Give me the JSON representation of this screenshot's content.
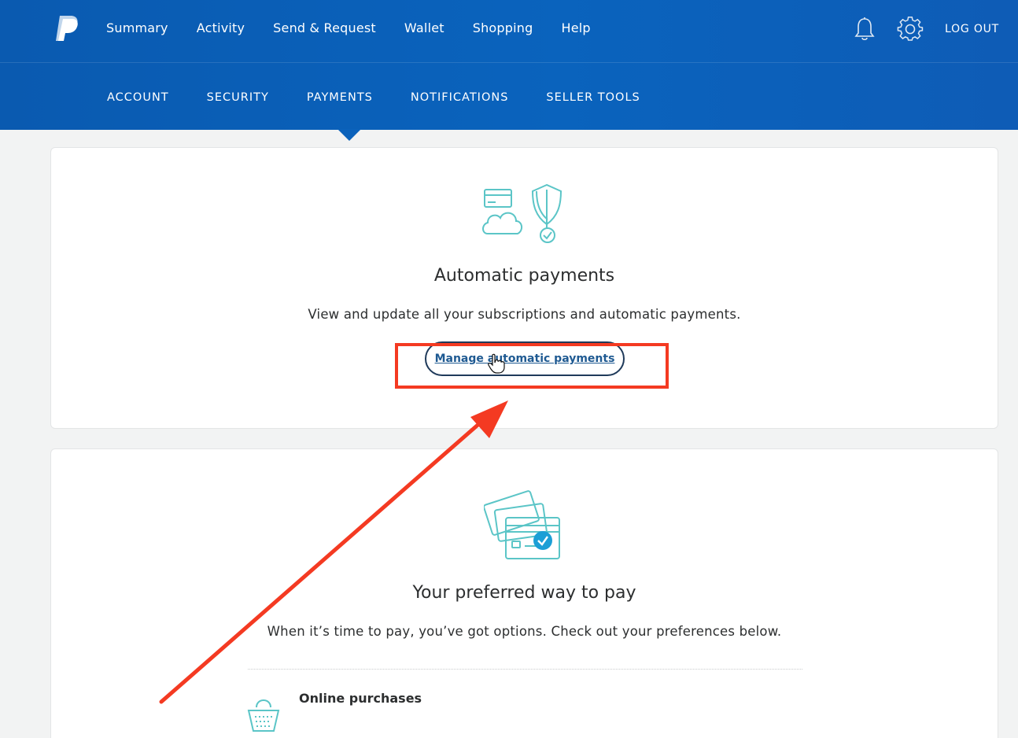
{
  "header": {
    "main_nav": [
      "Summary",
      "Activity",
      "Send & Request",
      "Wallet",
      "Shopping",
      "Help"
    ],
    "logout_label": "LOG OUT",
    "sub_nav": [
      "ACCOUNT",
      "SECURITY",
      "PAYMENTS",
      "NOTIFICATIONS",
      "SELLER TOOLS"
    ],
    "active_sub_nav": "PAYMENTS"
  },
  "automatic_payments": {
    "title": "Automatic payments",
    "description": "View and update all your subscriptions and automatic payments.",
    "button_label": "Manage automatic payments"
  },
  "preferred_payment": {
    "title": "Your preferred way to pay",
    "description": "When it’s time to pay, you’ve got options. Check out your preferences below.",
    "online_purchases_label": "Online purchases"
  },
  "colors": {
    "header_blue": "#0a5ab0",
    "annotation_red": "#f43a22",
    "icon_teal": "#5bc5c7"
  }
}
